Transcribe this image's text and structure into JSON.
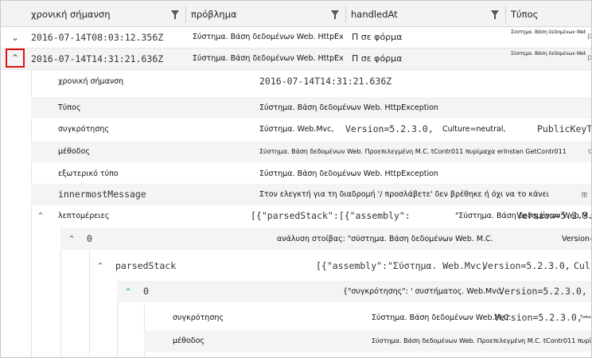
{
  "columns": [
    {
      "label": "χρονική σήμανση"
    },
    {
      "label": "πρόβλημα"
    },
    {
      "label": "handledAt"
    },
    {
      "label": "Τύπος"
    }
  ],
  "rows": [
    {
      "timestamp": "2016-07-14T08:03:12.356Z",
      "problem": "Σύστημα. Βάση δεδομένων Web. HttpException",
      "handledAt": "Π σε φόρμα",
      "type": "Σύστημα. Βάση δεδομένων Web. HttpException",
      "type_tail": "p",
      "expanded": false
    },
    {
      "timestamp": "2016-07-14T14:31:21.636Z",
      "problem": "Σύστημα. Βάση δεδομένων Web. HttpException",
      "handledAt": "Π σε φόρμα",
      "type": "Σύστημα. Βάση δεδομένων Web. HttpException",
      "type_tail": "p",
      "expanded": true
    }
  ],
  "details": {
    "timestamp": {
      "key": "χρονική σήμανση",
      "value": "2016-07-14T14:31:21.636Z"
    },
    "type": {
      "key": "Τύπος",
      "value": "Σύστημα. Βάση δεδομένων Web. HttpException"
    },
    "assembly": {
      "key": "συγκρότησης",
      "value": "Σύστημα. Web.Mvc,",
      "v2": "Version=5.2.3.0,",
      "v3": "Culture=neutral,",
      "v4": "PublicKeyT"
    },
    "method": {
      "key": "μέθοδος",
      "value": "Σύστημα. Βάση δεδομένων Web. Προεπιλεγμένη Μ.C. tContr011 πυρίμαχα erInstan GetContr011",
      "tail": "c"
    },
    "outerType": {
      "key": "εξωτερικό τύπο",
      "value": "Σύστημα. Βάση δεδομένων Web. HttpException"
    },
    "innermost": {
      "key": "innermostMessage",
      "value": "Στον ελεγκτή για τη διαδρομή '/ προσλάβετε' δεν βρέθηκε ή όχι να το κάνει",
      "tail": "m"
    },
    "details": {
      "key": "λεπτομέρειες",
      "value": "[{\"parsedStack\":[{\"assembly\":",
      "v2": "\"Σύστημα. Βάση δεδομένων Web.M.C.",
      "v3": "Version=5.2.3."
    },
    "item0": {
      "key": "0",
      "value": "ανάλυση στοίβας: \"σύστημα. Βάση δεδομένων Web. M.C.",
      "v2": "Version=5."
    },
    "parsedStack": {
      "key": "parsedStack",
      "value": "[{\"assembly\":\"Σύστημα. Web.Mvc,",
      "v2": "Version=5.2.3.0,",
      "v3": "Cul"
    },
    "stack0": {
      "key": "0",
      "value": "{\"συγκρότησης\": ' συστήματος. Web.Mvc,",
      "v2": "Version=5.2.3.0,"
    },
    "s_assembly": {
      "key": "συγκρότησης",
      "value": "Σύστημα. Βάση δεδομένων Web.M.C.",
      "v2": "Version=5.2.3.0,",
      "v3": "Τοπικός ρυθμίσεις"
    },
    "s_method": {
      "key": "μέθοδος",
      "value": "Σύστημα. Βάση δεδομένων Web. Προεπιλεγμένη Μ.C. tContr011 πυρίμαχα"
    }
  },
  "icons": {
    "expand": "chevron-down-icon",
    "collapse": "chevron-up-icon",
    "filter": "filter-icon"
  },
  "colors": {
    "selected_border": "#dd1111",
    "expand_cyan": "#1aa0d6"
  }
}
